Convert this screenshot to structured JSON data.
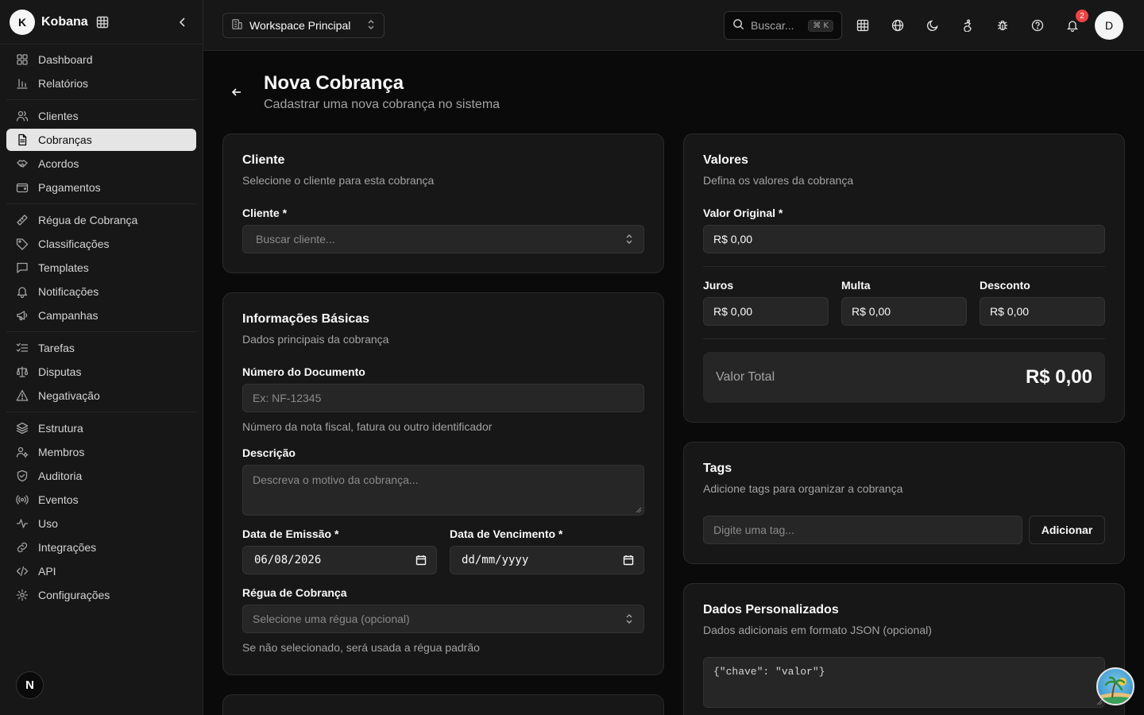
{
  "brand": {
    "initial": "K",
    "name": "Kobana"
  },
  "sidebar": {
    "groups": [
      [
        {
          "label": "Dashboard",
          "icon": "dashboard-icon"
        },
        {
          "label": "Relatórios",
          "icon": "bar-chart-icon"
        }
      ],
      [
        {
          "label": "Clientes",
          "icon": "users-icon"
        },
        {
          "label": "Cobranças",
          "icon": "file-text-icon",
          "active": true
        },
        {
          "label": "Acordos",
          "icon": "handshake-icon"
        },
        {
          "label": "Pagamentos",
          "icon": "wallet-icon"
        }
      ],
      [
        {
          "label": "Régua de Cobrança",
          "icon": "ruler-icon"
        },
        {
          "label": "Classificações",
          "icon": "tag-icon"
        },
        {
          "label": "Templates",
          "icon": "message-square-icon"
        },
        {
          "label": "Notificações",
          "icon": "bell-icon"
        },
        {
          "label": "Campanhas",
          "icon": "megaphone-icon"
        }
      ],
      [
        {
          "label": "Tarefas",
          "icon": "list-checks-icon"
        },
        {
          "label": "Disputas",
          "icon": "scale-icon"
        },
        {
          "label": "Negativação",
          "icon": "alert-triangle-icon"
        }
      ],
      [
        {
          "label": "Estrutura",
          "icon": "layers-icon"
        },
        {
          "label": "Membros",
          "icon": "users-cog-icon"
        },
        {
          "label": "Auditoria",
          "icon": "shield-icon"
        },
        {
          "label": "Eventos",
          "icon": "radio-icon"
        },
        {
          "label": "Uso",
          "icon": "activity-icon"
        },
        {
          "label": "Integrações",
          "icon": "link-icon"
        },
        {
          "label": "API",
          "icon": "code-icon"
        },
        {
          "label": "Configurações",
          "icon": "settings-icon"
        }
      ]
    ],
    "next_badge": "N"
  },
  "header": {
    "workspace": "Workspace Principal",
    "search_placeholder": "Buscar...",
    "search_shortcut": "⌘ K",
    "notification_count": "2",
    "user_initial": "D"
  },
  "page": {
    "title": "Nova Cobrança",
    "subtitle": "Cadastrar uma nova cobrança no sistema"
  },
  "cliente_card": {
    "title": "Cliente",
    "description": "Selecione o cliente para esta cobrança",
    "field_label": "Cliente *",
    "placeholder": "Buscar cliente..."
  },
  "info_card": {
    "title": "Informações Básicas",
    "description": "Dados principais da cobrança",
    "doc_label": "Número do Documento",
    "doc_placeholder": "Ex: NF-12345",
    "doc_help": "Número da nota fiscal, fatura ou outro identificador",
    "desc_label": "Descrição",
    "desc_placeholder": "Descreva o motivo da cobrança...",
    "emissao_label": "Data de Emissão *",
    "emissao_value": "06/08/2026",
    "vencimento_label": "Data de Vencimento *",
    "vencimento_value": "dd/mm/yyyy",
    "regua_label": "Régua de Cobrança",
    "regua_placeholder": "Selecione uma régua (opcional)",
    "regua_help": "Se não selecionado, será usada a régua padrão"
  },
  "valores_card": {
    "title": "Valores",
    "description": "Defina os valores da cobrança",
    "original_label": "Valor Original *",
    "original_value": "R$ 0,00",
    "juros_label": "Juros",
    "juros_value": "R$ 0,00",
    "multa_label": "Multa",
    "multa_value": "R$ 0,00",
    "desconto_label": "Desconto",
    "desconto_value": "R$ 0,00",
    "total_label": "Valor Total",
    "total_value": "R$ 0,00"
  },
  "tags_card": {
    "title": "Tags",
    "description": "Adicione tags para organizar a cobrança",
    "placeholder": "Digite uma tag...",
    "add_button": "Adicionar"
  },
  "custom_card": {
    "title": "Dados Personalizados",
    "description": "Dados adicionais em formato JSON (opcional)",
    "placeholder": "{\"chave\": \"valor\"}"
  }
}
